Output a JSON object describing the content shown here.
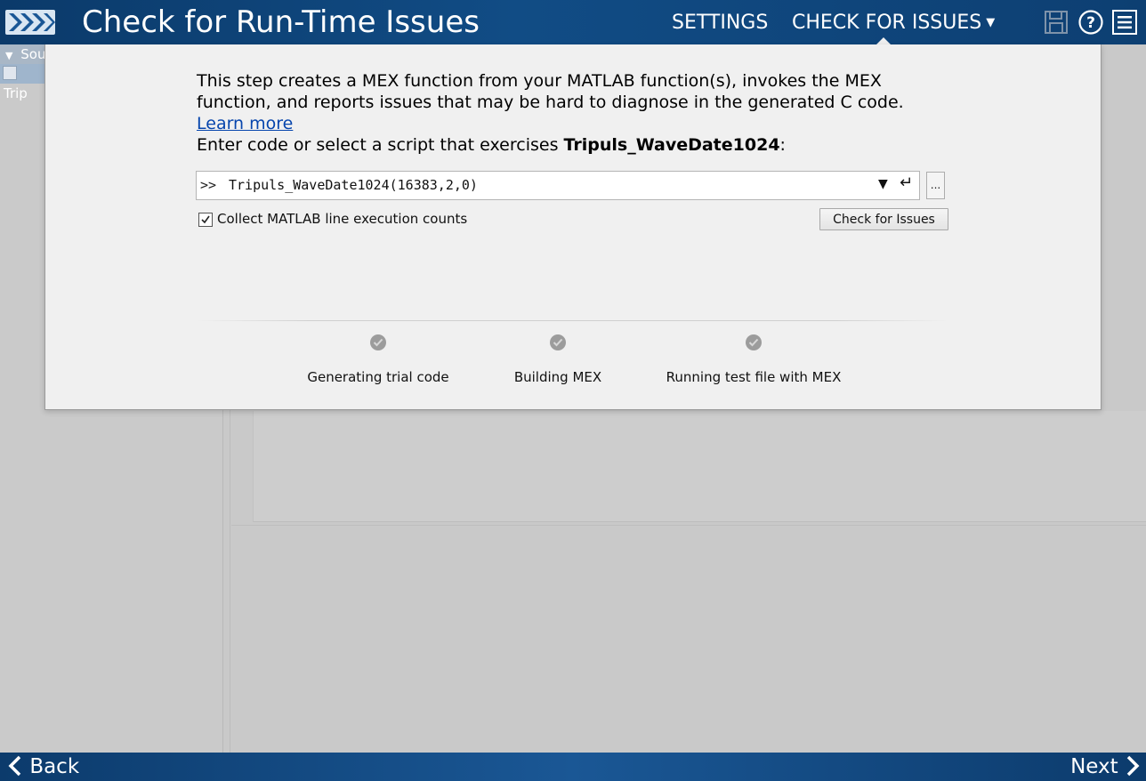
{
  "header": {
    "title": "Check for Run-Time Issues",
    "nav_settings": "SETTINGS",
    "nav_check": "CHECK FOR ISSUES",
    "icons": [
      "save-icon",
      "help-icon",
      "menu-icon"
    ]
  },
  "left_panel": {
    "tree_items": [
      "Sou",
      "Trip"
    ]
  },
  "dialog": {
    "description": "This step creates a MEX function from your MATLAB function(s), invokes the MEX function, and reports issues that may be hard to diagnose in the generated C code.",
    "learn_more": "Learn more",
    "prompt_prefix": "Enter code or select a script that exercises",
    "function_name": "Tripuls_WaveDate1024",
    "prompt_suffix": ":",
    "command_prompt": ">>",
    "command_value": "Tripuls_WaveDate1024(16383,2,0)",
    "browse_label": "...",
    "collect_label": "Collect MATLAB line execution counts",
    "collect_checked": true,
    "check_button": "Check for Issues",
    "steps": [
      {
        "label": "Generating trial code"
      },
      {
        "label": "Building MEX"
      },
      {
        "label": "Running test file with MEX"
      }
    ]
  },
  "footer": {
    "back": "Back",
    "next": "Next"
  },
  "colors": {
    "header_bg": "#114c85",
    "link": "#0645ad",
    "dialog_bg": "#f0f0f0",
    "step_icon": "#9a9a9a"
  }
}
